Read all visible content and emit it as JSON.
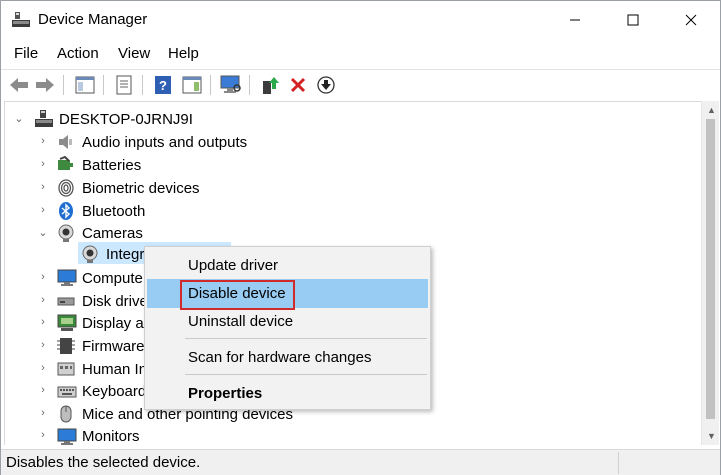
{
  "window": {
    "title": "Device Manager",
    "controls": {
      "minimize": "—",
      "maximize": "☐",
      "close": "✕"
    }
  },
  "menubar": [
    "File",
    "Action",
    "View",
    "Help"
  ],
  "toolbar": {
    "buttons": [
      "back-arrow-icon",
      "forward-arrow-icon",
      "show-hide-tree-icon",
      "properties-icon",
      "help-icon",
      "action-pane-icon",
      "scan-hardware-icon",
      "update-driver-icon",
      "uninstall-icon",
      "disable-device-icon"
    ]
  },
  "tree": {
    "root": "DESKTOP-0JRNJ9I",
    "items": [
      {
        "label": "Audio inputs and outputs",
        "icon": "speaker-icon",
        "expanded": false
      },
      {
        "label": "Batteries",
        "icon": "battery-icon",
        "expanded": false
      },
      {
        "label": "Biometric devices",
        "icon": "fingerprint-icon",
        "expanded": false
      },
      {
        "label": "Bluetooth",
        "icon": "bluetooth-icon",
        "expanded": false
      },
      {
        "label": "Cameras",
        "icon": "camera-icon",
        "expanded": true
      },
      {
        "label": "Integr",
        "icon": "webcam-icon",
        "child": true
      },
      {
        "label": "Compute",
        "icon": "monitor-icon",
        "expanded": false
      },
      {
        "label": "Disk drive",
        "icon": "disk-drive-icon",
        "expanded": false
      },
      {
        "label": "Display ad",
        "icon": "display-adapter-icon",
        "expanded": false
      },
      {
        "label": "Firmware",
        "icon": "firmware-icon",
        "expanded": false
      },
      {
        "label": "Human In",
        "icon": "hid-icon",
        "expanded": false
      },
      {
        "label": "Keyboard",
        "icon": "keyboard-icon",
        "expanded": false
      },
      {
        "label": "Mice and other pointing devices",
        "icon": "mouse-icon",
        "expanded": false
      },
      {
        "label": "Monitors",
        "icon": "monitor-icon",
        "expanded": false
      }
    ]
  },
  "context_menu": {
    "items": [
      "Update driver",
      "Disable device",
      "Uninstall device",
      "Scan for hardware changes",
      "Properties"
    ],
    "highlighted": "Disable device"
  },
  "statusbar": {
    "text": "Disables the selected device."
  },
  "colors": {
    "highlight": "#99ccf3",
    "selection": "#cce8ff",
    "annotation_box": "#d12a2a"
  }
}
